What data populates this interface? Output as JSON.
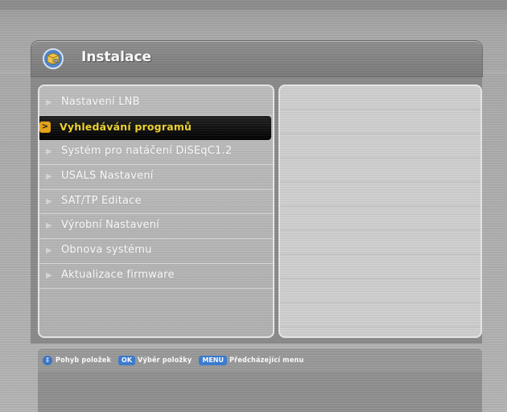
{
  "window": {
    "title": "Instalace",
    "icon": "gear-box-icon"
  },
  "menu": {
    "selected_index": 1,
    "items": [
      {
        "label": "Nastavení LNB"
      },
      {
        "label": "Vyhledávání programů"
      },
      {
        "label": "Systém pro natáčení DiSEqC1.2"
      },
      {
        "label": "USALS Nastavení"
      },
      {
        "label": "SAT/TP Editace"
      },
      {
        "label": "Výrobní Nastavení"
      },
      {
        "label": "Obnova systému"
      },
      {
        "label": "Aktualizace firmware"
      }
    ]
  },
  "help": {
    "move_icon": "up-down-icon",
    "move_label": "Pohyb položek",
    "ok_key": "OK",
    "ok_label": "Výběr položky",
    "menu_key": "MENU",
    "menu_label": "Předcházející menu"
  },
  "colors": {
    "selected_bg": "#000000",
    "selected_text": "#f1d52c",
    "selected_marker": "#e6a417",
    "key_badge": "#3a7bd0"
  }
}
